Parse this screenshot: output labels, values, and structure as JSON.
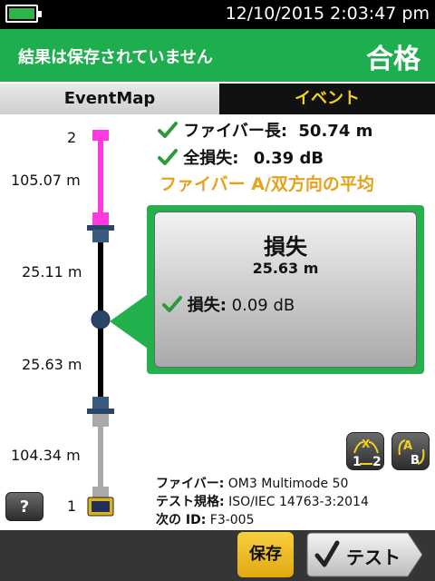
{
  "status": {
    "datetime": "12/10/2015 2:03:47 pm",
    "battery_icon": "battery-icon"
  },
  "result": {
    "message": "結果は保存されていません",
    "verdict": "合格",
    "color": "#1fae4f"
  },
  "tabs": [
    {
      "label": "EventMap",
      "active": true
    },
    {
      "label": "イベント",
      "active": false
    }
  ],
  "map": {
    "connectors": {
      "top": "2",
      "bottom": "1"
    },
    "segments": [
      "105.07 m",
      "25.11 m",
      "25.63 m",
      "104.34 m"
    ],
    "colors": {
      "launch": "#ff39e0",
      "fiber": "#000000",
      "tail": "#a9a9a9",
      "connector": "#2b4566"
    }
  },
  "measurements": {
    "length_label": "ファイバー長:",
    "length_value": "50.74 m",
    "loss_label": "全損失:",
    "loss_value": "0.39 dB",
    "average_note": "ファイバー A/双方向の平均"
  },
  "popup": {
    "title": "損失",
    "value": "25.63 m",
    "loss_label": "損失:",
    "loss_value": "0.09 dB"
  },
  "info": {
    "fiber_label": "ファイバー:",
    "fiber_value": "OM3 Multimode 50",
    "standard_label": "テスト規格:",
    "standard_value": "ISO/IEC 14763-3:2014",
    "nextid_label": "次の ID:",
    "nextid_value": "F3-005"
  },
  "buttons": {
    "help": "?",
    "save": "保存",
    "test": "テスト",
    "swap_ends_icon": "swap-ends-icon",
    "swap_ab_icon": "swap-ab-icon"
  }
}
